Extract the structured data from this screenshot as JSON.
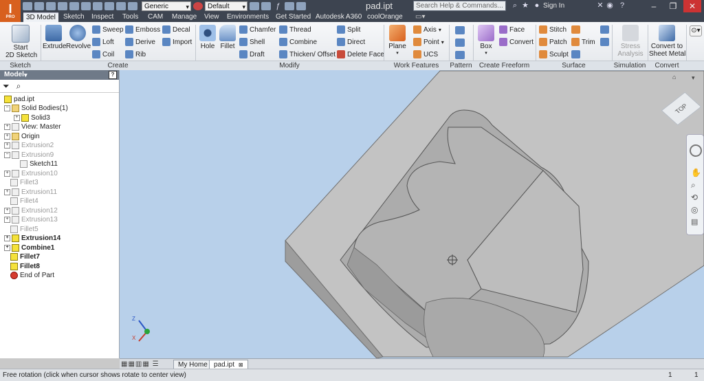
{
  "app": {
    "logo_letter": "I",
    "logo_badge": "PRO",
    "document_title": "pad.ipt"
  },
  "quick_access": {
    "appearance_dropdown": "Generic",
    "material_dropdown": "Default",
    "help_search_placeholder": "Search Help & Commands...",
    "sign_in": "Sign In"
  },
  "tabs": [
    {
      "label": "3D Model"
    },
    {
      "label": "Sketch"
    },
    {
      "label": "Inspect"
    },
    {
      "label": "Tools"
    },
    {
      "label": "CAM"
    },
    {
      "label": "Manage"
    },
    {
      "label": "View"
    },
    {
      "label": "Environments"
    },
    {
      "label": "Get Started"
    },
    {
      "label": "Autodesk A360"
    },
    {
      "label": "coolOrange"
    }
  ],
  "ribbon": {
    "sketch": {
      "start_line1": "Start",
      "start_line2": "2D Sketch",
      "panel": "Sketch"
    },
    "create": {
      "extrude": "Extrude",
      "revolve": "Revolve",
      "sweep": "Sweep",
      "loft": "Loft",
      "coil": "Coil",
      "emboss": "Emboss",
      "derive": "Derive",
      "rib": "Rib",
      "decal": "Decal",
      "import": "Import",
      "panel": "Create"
    },
    "modify": {
      "hole": "Hole",
      "fillet": "Fillet",
      "chamfer": "Chamfer",
      "shell": "Shell",
      "draft": "Draft",
      "thread": "Thread",
      "combine": "Combine",
      "thicken_offset": "Thicken/ Offset",
      "split": "Split",
      "direct": "Direct",
      "delete_face": "Delete Face",
      "panel": "Modify"
    },
    "work_features": {
      "plane": "Plane",
      "axis": "Axis",
      "point": "Point",
      "ucs": "UCS",
      "panel": "Work Features"
    },
    "pattern": {
      "panel": "Pattern"
    },
    "freeform": {
      "box": "Box",
      "face": "Face",
      "convert": "Convert",
      "panel": "Create Freeform"
    },
    "surface": {
      "stitch": "Stitch",
      "patch": "Patch",
      "sculpt": "Sculpt",
      "trim": "Trim",
      "panel": "Surface"
    },
    "simulation": {
      "stress_line1": "Stress",
      "stress_line2": "Analysis",
      "panel": "Simulation"
    },
    "convert": {
      "sheet_line1": "Convert to",
      "sheet_line2": "Sheet Metal",
      "panel": "Convert"
    }
  },
  "browser": {
    "title": "Model",
    "tree": [
      {
        "label": "pad.ipt"
      },
      {
        "label": "Solid Bodies(1)"
      },
      {
        "label": "Solid3"
      },
      {
        "label": "View: Master"
      },
      {
        "label": "Origin"
      },
      {
        "label": "Extrusion2"
      },
      {
        "label": "Extrusion9"
      },
      {
        "label": "Sketch11"
      },
      {
        "label": "Extrusion10"
      },
      {
        "label": "Fillet3"
      },
      {
        "label": "Extrusion11"
      },
      {
        "label": "Fillet4"
      },
      {
        "label": "Extrusion12"
      },
      {
        "label": "Extrusion13"
      },
      {
        "label": "Fillet5"
      },
      {
        "label": "Extrusion14"
      },
      {
        "label": "Combine1"
      },
      {
        "label": "Fillet7"
      },
      {
        "label": "Fillet8"
      },
      {
        "label": "End of Part"
      }
    ]
  },
  "viewcube": {
    "face_label": "TOP"
  },
  "doc_tabs": [
    {
      "label": "My Home"
    },
    {
      "label": "pad.ipt"
    }
  ],
  "status": {
    "message": "Free rotation (click when cursor shows rotate to center view)",
    "count1": "1",
    "count2": "1"
  },
  "colors": {
    "accent": "#d8601e",
    "viewport": "#b8d0ea",
    "part": "#b7b7b7"
  }
}
